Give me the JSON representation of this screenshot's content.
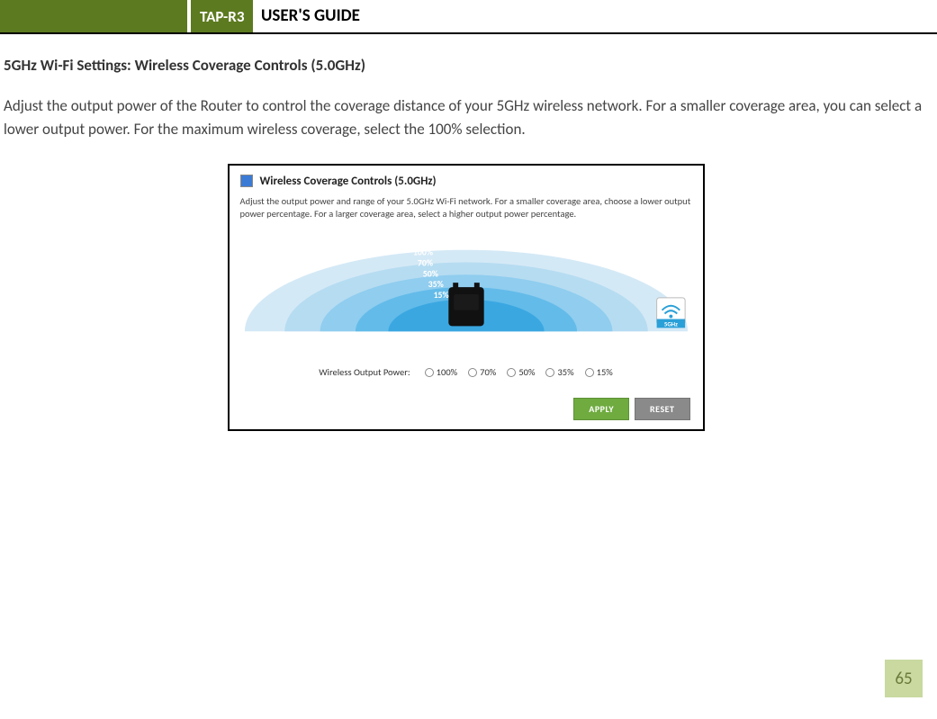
{
  "header": {
    "model": "TAP-R3",
    "guide": "USER'S GUIDE"
  },
  "section": {
    "title": "5GHz Wi-Fi Settings: Wireless Coverage Controls (5.0GHz)",
    "body": "Adjust the output power of the Router to control the coverage distance of your 5GHz wireless network.  For a smaller coverage area, you can select a lower output power. For the maximum wireless coverage, select the 100% selection."
  },
  "panel": {
    "title": "Wireless Coverage Controls (5.0GHz)",
    "desc": "Adjust the output power and range of your 5.0GHz Wi-Fi network. For a smaller coverage area, choose a lower output power percentage. For a larger coverage area, select a higher output power percentage.",
    "arc_labels": [
      "100%",
      "70%",
      "50%",
      "35%",
      "15%"
    ],
    "badge": "5GHz",
    "power_label": "Wireless Output Power:",
    "options": [
      "100%",
      "70%",
      "50%",
      "35%",
      "15%"
    ],
    "apply": "APPLY",
    "reset": "RESET"
  },
  "page_number": "65"
}
